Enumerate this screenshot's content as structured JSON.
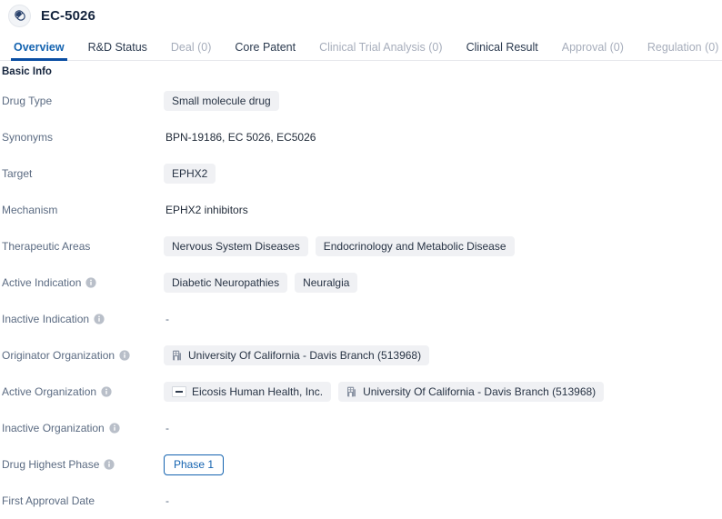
{
  "header": {
    "icon": "pill-capsule-icon",
    "title": "EC-5026"
  },
  "tabs": [
    {
      "label": "Overview",
      "state": "active"
    },
    {
      "label": "R&D Status",
      "state": "normal"
    },
    {
      "label": "Deal (0)",
      "state": "muted"
    },
    {
      "label": "Core Patent",
      "state": "normal"
    },
    {
      "label": "Clinical Trial Analysis (0)",
      "state": "muted"
    },
    {
      "label": "Clinical Result",
      "state": "normal"
    },
    {
      "label": "Approval (0)",
      "state": "muted"
    },
    {
      "label": "Regulation (0)",
      "state": "muted"
    }
  ],
  "section": {
    "title": "Basic Info"
  },
  "rows": [
    {
      "label": "Drug Type",
      "info": false,
      "type": "tags",
      "tags": [
        {
          "text": "Small molecule drug",
          "icon": "none"
        }
      ]
    },
    {
      "label": "Synonyms",
      "info": false,
      "type": "text",
      "text": "BPN-19186,  EC 5026,  EC5026"
    },
    {
      "label": "Target",
      "info": false,
      "type": "tags",
      "tags": [
        {
          "text": "EPHX2",
          "icon": "none"
        }
      ]
    },
    {
      "label": "Mechanism",
      "info": false,
      "type": "text",
      "text": "EPHX2 inhibitors"
    },
    {
      "label": "Therapeutic Areas",
      "info": false,
      "type": "tags",
      "tags": [
        {
          "text": "Nervous System Diseases",
          "icon": "none"
        },
        {
          "text": "Endocrinology and Metabolic Disease",
          "icon": "none"
        }
      ]
    },
    {
      "label": "Active Indication",
      "info": true,
      "type": "tags",
      "tags": [
        {
          "text": "Diabetic Neuropathies",
          "icon": "none"
        },
        {
          "text": "Neuralgia",
          "icon": "none"
        }
      ]
    },
    {
      "label": "Inactive Indication",
      "info": true,
      "type": "dash",
      "text": "-"
    },
    {
      "label": "Originator Organization",
      "info": true,
      "type": "tags",
      "tags": [
        {
          "text": "University Of California - Davis Branch (513968)",
          "icon": "organization-icon"
        }
      ]
    },
    {
      "label": "Active Organization",
      "info": true,
      "type": "tags",
      "tags": [
        {
          "text": "Eicosis Human Health, Inc.",
          "icon": "company-logo-icon"
        },
        {
          "text": "University Of California - Davis Branch (513968)",
          "icon": "organization-icon"
        }
      ]
    },
    {
      "label": "Inactive Organization",
      "info": true,
      "type": "dash",
      "text": "-"
    },
    {
      "label": "Drug Highest Phase",
      "info": true,
      "type": "phase",
      "text": "Phase 1"
    },
    {
      "label": "First Approval Date",
      "info": false,
      "type": "dash",
      "text": "-"
    }
  ],
  "colors": {
    "accent": "#1463b0",
    "active_tab_underline": "#0a4ea3",
    "label": "#5b6b82",
    "value": "#1f2937",
    "tag_bg": "#f0f1f4",
    "muted_tab": "#a6adbb"
  }
}
